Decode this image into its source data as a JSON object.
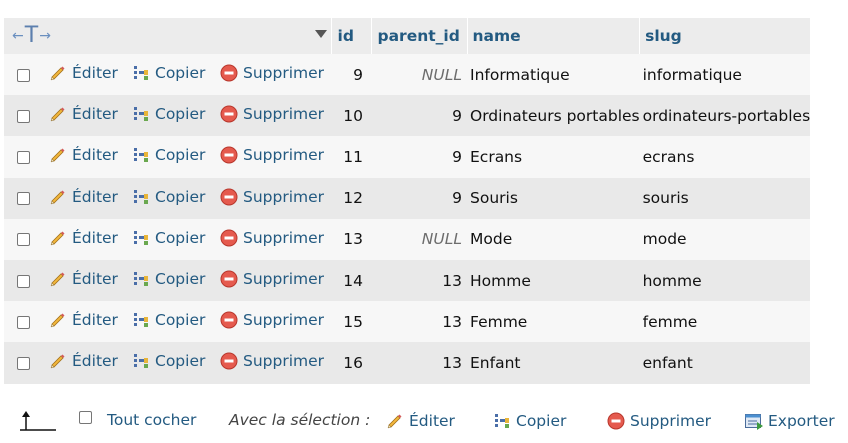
{
  "header": {
    "columns": [
      "id",
      "parent_id",
      "name",
      "slug"
    ]
  },
  "row_actions": {
    "edit": "Éditer",
    "copy": "Copier",
    "delete": "Supprimer"
  },
  "rows": [
    {
      "id": "9",
      "parent_id": "NULL",
      "name": "Informatique",
      "slug": "informatique"
    },
    {
      "id": "10",
      "parent_id": "9",
      "name": "Ordinateurs portables",
      "slug": "ordinateurs-portables"
    },
    {
      "id": "11",
      "parent_id": "9",
      "name": "Ecrans",
      "slug": "ecrans"
    },
    {
      "id": "12",
      "parent_id": "9",
      "name": "Souris",
      "slug": "souris"
    },
    {
      "id": "13",
      "parent_id": "NULL",
      "name": "Mode",
      "slug": "mode"
    },
    {
      "id": "14",
      "parent_id": "13",
      "name": "Homme",
      "slug": "homme"
    },
    {
      "id": "15",
      "parent_id": "13",
      "name": "Femme",
      "slug": "femme"
    },
    {
      "id": "16",
      "parent_id": "13",
      "name": "Enfant",
      "slug": "enfant"
    }
  ],
  "footer": {
    "check_all": "Tout cocher",
    "with_selection": "Avec la sélection :",
    "edit": "Éditer",
    "copy": "Copier",
    "delete": "Supprimer",
    "export": "Exporter"
  },
  "colors": {
    "link": "#235a81",
    "header_bg": "#ececec",
    "row_odd": "#f7f7f7",
    "row_even": "#e9e9e9",
    "null_text": "#6d6d6d"
  },
  "icons": {
    "edit": "pencil-icon",
    "copy": "copy-icon",
    "delete": "delete-icon",
    "export": "export-icon",
    "sort": "sort-triangle-icon",
    "column-move": "column-arrows-icon",
    "select-arrow": "arrow-up-icon"
  }
}
